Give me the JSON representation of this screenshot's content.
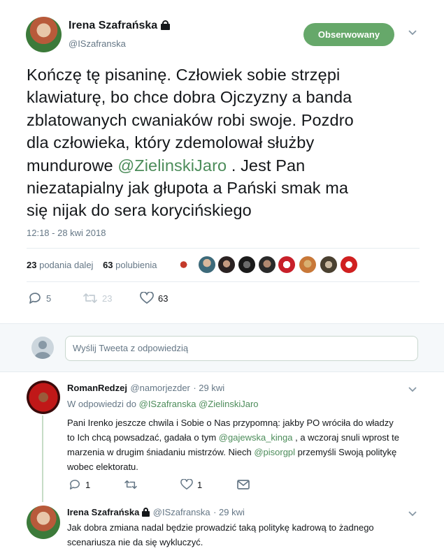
{
  "tweet": {
    "author_name": "Irena Szafrańska",
    "author_handle": "@ISzafranska",
    "follow_label": "Obserwowany",
    "text_lines": [
      "Kończę tę pisaninę. Człowiek sobie strzępi",
      "klawiaturę, bo chce dobra Ojczyzny a banda",
      "zblatowanych cwaniaków robi swoje. Pozdro",
      "dla człowieka, który zdemolował służby"
    ],
    "text_line5_before": "mundurowe ",
    "text_line5_mention": "@ZielinskiJaro",
    "text_line5_after": " . Jest Pan",
    "text_lines_end": [
      "niezatapialny jak głupota a Pański smak ma",
      "się nijak do sera korycińskiego"
    ],
    "timestamp": "12:18 - 28 kwi 2018",
    "retweets_count": "23",
    "retweets_label": "podania dalej",
    "likes_count": "63",
    "likes_label": "polubienia",
    "replies": "5",
    "retweets": "23",
    "likes": "63"
  },
  "reply_box": {
    "placeholder": "Wyślij Tweeta z odpowiedzią"
  },
  "replies": [
    {
      "name": "RomanRedzej",
      "handle": "@namorjezder",
      "date": "· 29 kwi",
      "in_reply_prefix": "W odpowiedzi do",
      "in_reply_to_1": "@ISzafranska",
      "in_reply_to_2": "@ZielinskiJaro",
      "line1": "Pani Irenko jeszcze chwila i Sobie o Nas przypomną: jakby PO wróciła do władzy",
      "line2_before": "to Ich chcą powsadzać, gadała o tym ",
      "line2_mention": "@gajewska_kinga",
      "line2_after": " , a wczoraj snuli wprost te",
      "line3_before": "marzenia w drugim śniadaniu mistrzów. Niech ",
      "line3_mention": "@pisorgpl",
      "line3_after": " przemyśli Swoją politykę",
      "line4": "wobec elektoratu.",
      "reply_count": "1",
      "like_count": "1"
    },
    {
      "name": "Irena Szafrańska",
      "handle": "@ISzafranska",
      "date": "· 29 kwi",
      "line1": "Jak dobra zmiana nadal będzie prowadzić taką politykę kadrową to żadnego",
      "line2": "scenariusza nie da się wykluczyć."
    }
  ],
  "colors": {
    "accent": "#66a86a",
    "link": "#4c8c5a",
    "muted": "#657786"
  }
}
